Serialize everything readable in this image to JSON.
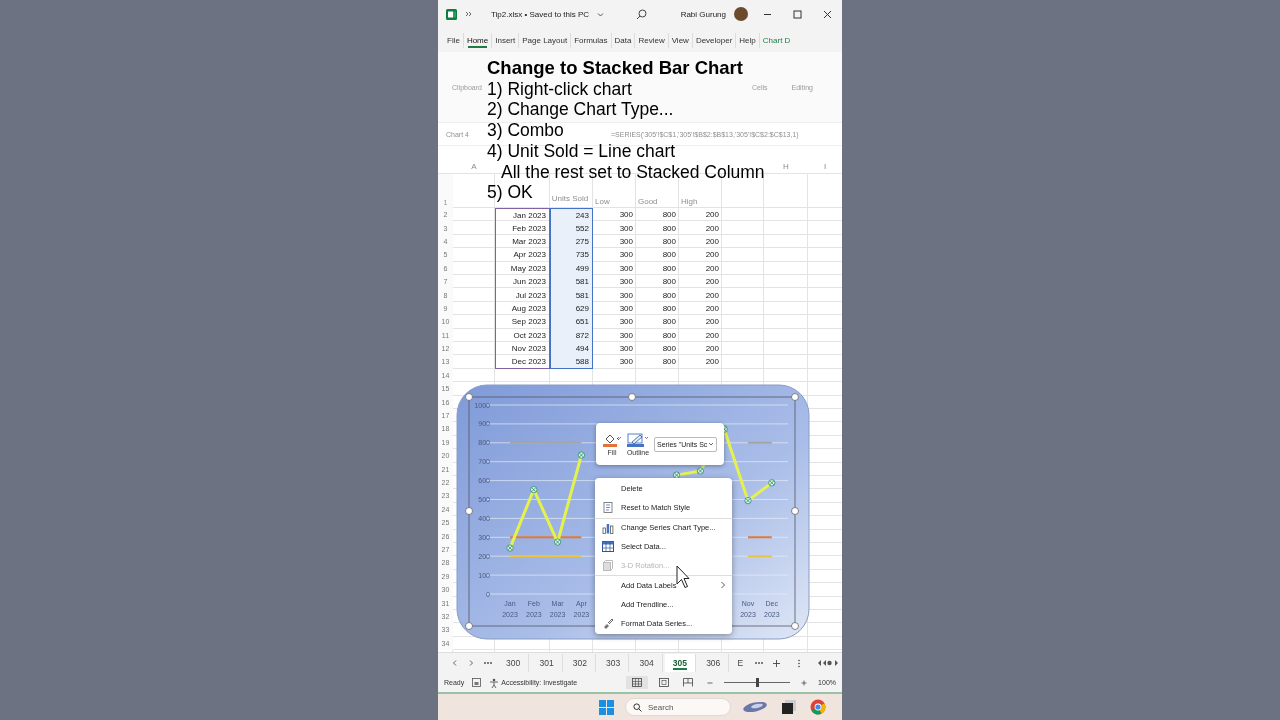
{
  "title_bar": {
    "document": "Tip2.xlsx • Saved to this PC",
    "user": "Rabi Gurung"
  },
  "menu_tabs": [
    {
      "label": "File",
      "selected": false,
      "kind": "normal"
    },
    {
      "label": "Home",
      "selected": true,
      "kind": "normal"
    },
    {
      "label": "Insert",
      "selected": false,
      "kind": "normal"
    },
    {
      "label": "Page Layout",
      "selected": false,
      "kind": "normal"
    },
    {
      "label": "Formulas",
      "selected": false,
      "kind": "normal"
    },
    {
      "label": "Data",
      "selected": false,
      "kind": "normal"
    },
    {
      "label": "Review",
      "selected": false,
      "kind": "normal"
    },
    {
      "label": "View",
      "selected": false,
      "kind": "normal"
    },
    {
      "label": "Developer",
      "selected": false,
      "kind": "normal"
    },
    {
      "label": "Help",
      "selected": false,
      "kind": "normal"
    },
    {
      "label": "Chart D",
      "selected": false,
      "kind": "contextual"
    }
  ],
  "ribbon_groups": [
    "Clipboard",
    "Cells",
    "Editing"
  ],
  "formula_bar": {
    "name_box": "Chart 4",
    "formula": "=SERIES('305'!$C$1,'305'!$B$2:$B$13,'305'!$C$2:$C$13,1)"
  },
  "caption": {
    "title": "Change to Stacked Bar Chart",
    "steps": [
      {
        "text": "1) Right-click chart",
        "kind": "step"
      },
      {
        "text": "2) Change Chart Type...",
        "kind": "step"
      },
      {
        "text": "3) Combo",
        "kind": "step"
      },
      {
        "text": "4) Unit Sold = Line chart",
        "kind": "step"
      },
      {
        "text": "All the rest set to Stacked Column",
        "kind": "note"
      },
      {
        "text": "5) OK",
        "kind": "step"
      }
    ]
  },
  "sheet": {
    "column_headers": {
      "a": "A",
      "h": "H",
      "i": "I"
    },
    "range_outlines": {
      "month": {
        "color": "#8064a2"
      },
      "units": {
        "color": "#4472c4"
      }
    },
    "header_row": {
      "number": "1",
      "units": "Units Sold",
      "low": "Low",
      "good": "Good",
      "high": "High"
    },
    "rows": [
      {
        "number": "2",
        "month": "Jan 2023",
        "units": "243",
        "low": "300",
        "good": "800",
        "high": "200"
      },
      {
        "number": "3",
        "month": "Feb 2023",
        "units": "552",
        "low": "300",
        "good": "800",
        "high": "200"
      },
      {
        "number": "4",
        "month": "Mar 2023",
        "units": "275",
        "low": "300",
        "good": "800",
        "high": "200"
      },
      {
        "number": "5",
        "month": "Apr 2023",
        "units": "735",
        "low": "300",
        "good": "800",
        "high": "200"
      },
      {
        "number": "6",
        "month": "May 2023",
        "units": "499",
        "low": "300",
        "good": "800",
        "high": "200"
      },
      {
        "number": "7",
        "month": "Jun 2023",
        "units": "581",
        "low": "300",
        "good": "800",
        "high": "200"
      },
      {
        "number": "8",
        "month": "Jul 2023",
        "units": "581",
        "low": "300",
        "good": "800",
        "high": "200"
      },
      {
        "number": "9",
        "month": "Aug 2023",
        "units": "629",
        "low": "300",
        "good": "800",
        "high": "200"
      },
      {
        "number": "10",
        "month": "Sep 2023",
        "units": "651",
        "low": "300",
        "good": "800",
        "high": "200"
      },
      {
        "number": "11",
        "month": "Oct 2023",
        "units": "872",
        "low": "300",
        "good": "800",
        "high": "200"
      },
      {
        "number": "12",
        "month": "Nov 2023",
        "units": "494",
        "low": "300",
        "good": "800",
        "high": "200"
      },
      {
        "number": "13",
        "month": "Dec 2023",
        "units": "588",
        "low": "300",
        "good": "800",
        "high": "200"
      }
    ],
    "empty_row_numbers": [
      "14",
      "15",
      "16",
      "17",
      "18",
      "19",
      "20",
      "21",
      "22",
      "23",
      "24",
      "25",
      "26",
      "27",
      "28",
      "29",
      "30",
      "31",
      "32",
      "33",
      "34"
    ]
  },
  "chart": {
    "chart_data": {
      "type": "line",
      "categories": [
        "Jan 2023",
        "Feb 2023",
        "Mar 2023",
        "Apr 2023",
        null,
        null,
        null,
        null,
        null,
        null,
        "Nov 2023",
        "Dec 2023"
      ],
      "ylim": [
        0,
        1000
      ],
      "yticks": [
        0,
        100,
        200,
        300,
        400,
        500,
        600,
        700,
        800,
        900,
        1000
      ],
      "grid": true,
      "series": [
        {
          "color": "#e6f24c",
          "marker": "circle",
          "values": [
            243,
            552,
            275,
            735,
            null,
            null,
            null,
            629,
            651,
            872,
            494,
            588
          ]
        },
        {
          "color": "#e07a3a",
          "values": [
            300,
            300,
            300,
            300,
            null,
            null,
            null,
            null,
            null,
            null,
            300,
            300
          ]
        },
        {
          "color": "#a5a5a5",
          "values": [
            800,
            800,
            800,
            800,
            null,
            null,
            null,
            null,
            null,
            null,
            800,
            800
          ]
        },
        {
          "color": "#e9c43c",
          "values": [
            200,
            200,
            200,
            200,
            null,
            null,
            null,
            null,
            null,
            null,
            200,
            200
          ]
        }
      ]
    }
  },
  "mini_toolbar": {
    "buttons": [
      {
        "label": "Fill",
        "kind": "fill"
      },
      {
        "label": "Outline",
        "kind": "outline"
      }
    ],
    "series_dropdown": "Series \"Units Sc"
  },
  "context_menu": [
    {
      "label": "Delete",
      "kind": "plain",
      "disabled": false,
      "submenu": false,
      "separator_before": false
    },
    {
      "label": "Reset to Match Style",
      "kind": "reset",
      "disabled": false,
      "submenu": false,
      "separator_before": false
    },
    {
      "label": "Change Series Chart Type...",
      "kind": "chart-type",
      "disabled": false,
      "submenu": false,
      "separator_before": true
    },
    {
      "label": "Select Data...",
      "kind": "select-data",
      "disabled": false,
      "submenu": false,
      "separator_before": false
    },
    {
      "label": "3-D Rotation...",
      "kind": "rotation",
      "disabled": true,
      "submenu": false,
      "separator_before": false
    },
    {
      "label": "Add Data Labels",
      "kind": "plain",
      "disabled": false,
      "submenu": true,
      "separator_before": true
    },
    {
      "label": "Add Trendline...",
      "kind": "plain",
      "disabled": false,
      "submenu": false,
      "separator_before": false
    },
    {
      "label": "Format Data Series...",
      "kind": "format",
      "disabled": false,
      "submenu": false,
      "separator_before": false
    }
  ],
  "sheet_tabs": [
    {
      "label": "300",
      "selected": false
    },
    {
      "label": "301",
      "selected": false
    },
    {
      "label": "302",
      "selected": false
    },
    {
      "label": "303",
      "selected": false
    },
    {
      "label": "304",
      "selected": false
    },
    {
      "label": "305",
      "selected": true
    },
    {
      "label": "306",
      "selected": false
    },
    {
      "label": "E",
      "selected": false
    }
  ],
  "status_bar": {
    "mode": "Ready",
    "accessibility": "Accessibility: Investigate",
    "zoom": {
      "level": 0.5,
      "reading": "100%"
    }
  },
  "taskbar": {
    "search": {
      "placeholder": "Search"
    }
  }
}
